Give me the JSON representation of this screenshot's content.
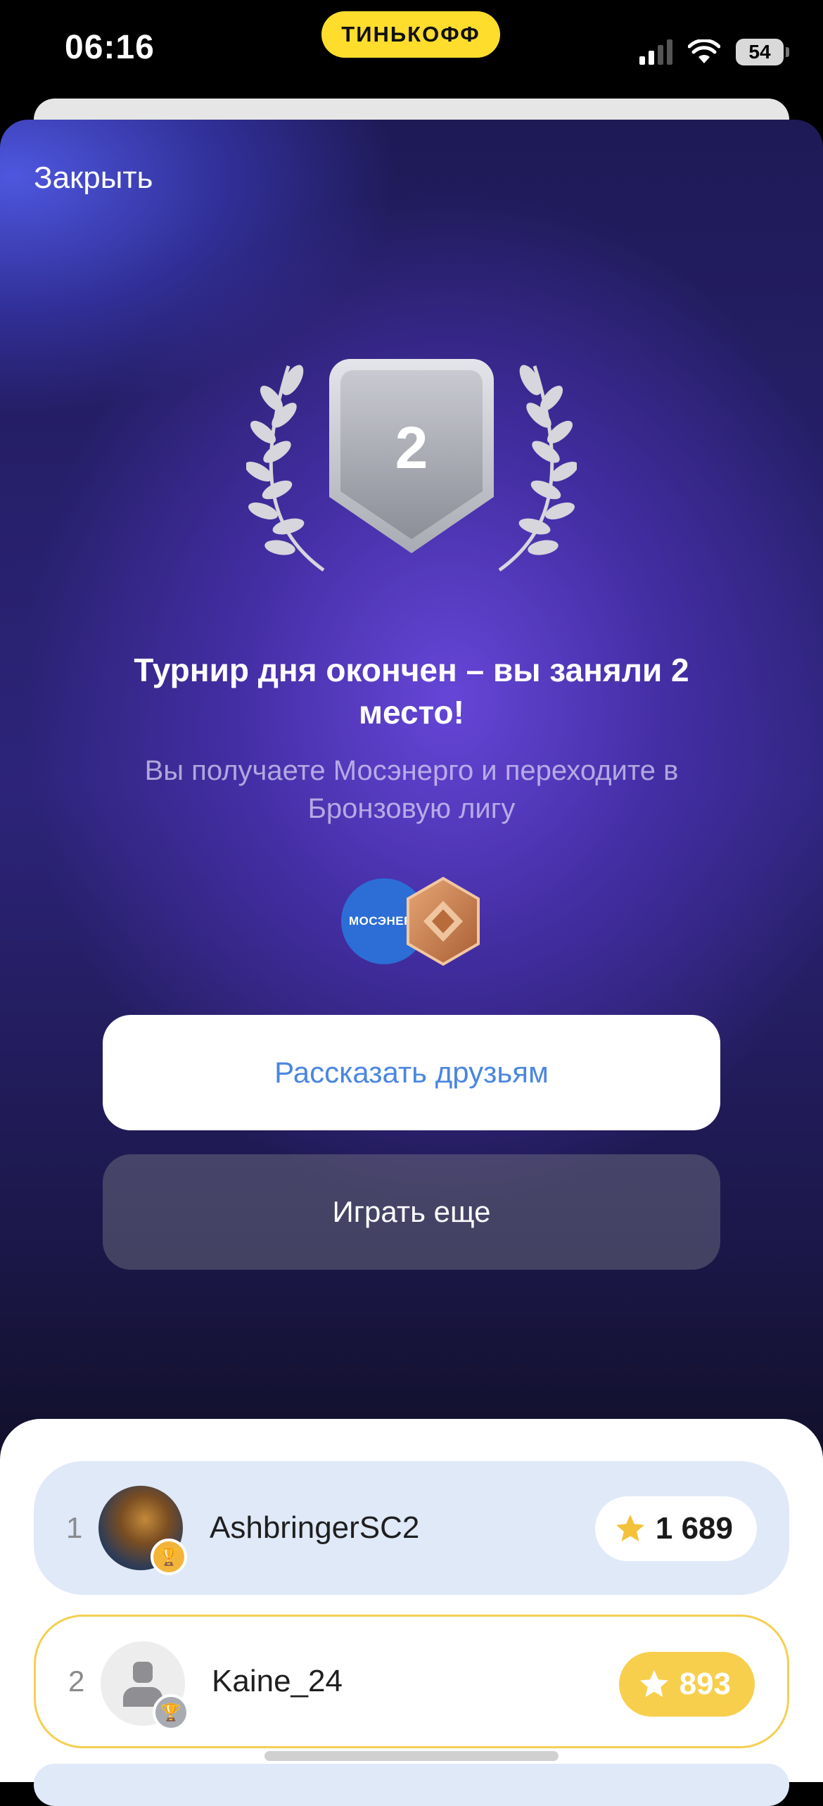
{
  "status_bar": {
    "time": "06:16",
    "carrier_badge": "ТИНЬКОФФ",
    "battery": "54",
    "icons": [
      "signal-icon",
      "wifi-icon",
      "battery-icon"
    ]
  },
  "modal": {
    "close_label": "Закрыть",
    "place_number": "2",
    "title": "Турнир дня окончен – вы заняли 2 место!",
    "subtitle": "Вы получаете Мосэнерго и переходите в Бронзовую лигу",
    "reward_brand_label": "МОСЭНЕРГ",
    "share_button": "Рассказать друзьям",
    "play_again_button": "Играть еще",
    "colors": {
      "accent_blue": "#4a86e0",
      "brand_yellow": "#FFDD2D",
      "bronze": "#c8814a"
    }
  },
  "leaderboard": {
    "rows": [
      {
        "rank": "1",
        "name": "AshbringerSC2",
        "score": "1 689",
        "highlight": "blue"
      },
      {
        "rank": "2",
        "name": "Kaine_24",
        "score": "893",
        "highlight": "current-user"
      }
    ]
  }
}
